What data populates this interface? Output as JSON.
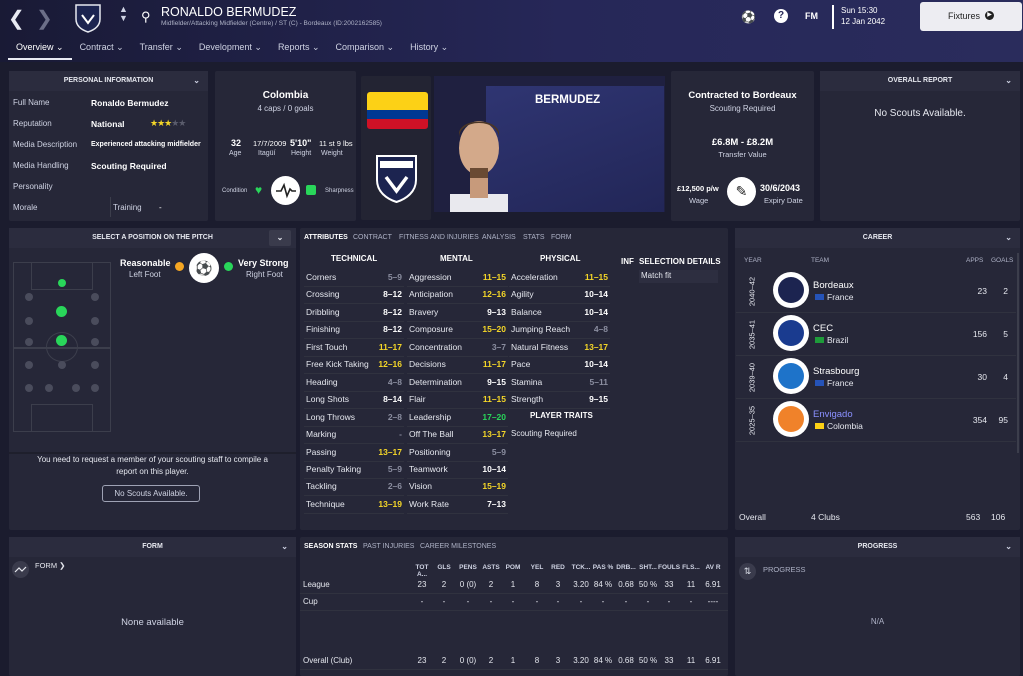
{
  "header": {
    "player_name": "RONALDO BERMUDEZ",
    "player_subtitle": "Midfielder/Attacking Midfielder (Centre) / ST (C) - Bordeaux (ID:2002162585)",
    "fm_label": "FM",
    "day_time": "Sun 15:30",
    "date": "12 Jan 2042",
    "continue_label": "Fixtures"
  },
  "tabs": [
    {
      "label": "Overview"
    },
    {
      "label": "Contract"
    },
    {
      "label": "Transfer"
    },
    {
      "label": "Development"
    },
    {
      "label": "Reports"
    },
    {
      "label": "Comparison"
    },
    {
      "label": "History"
    }
  ],
  "personal": {
    "title": "PERSONAL INFORMATION",
    "rows": [
      {
        "key": "Full Name",
        "value": "Ronaldo Bermudez"
      },
      {
        "key": "Reputation",
        "value": "National"
      },
      {
        "key": "Media Description",
        "value": "Experienced attacking midfielder"
      },
      {
        "key": "Media Handling",
        "value": "Scouting Required"
      },
      {
        "key": "Personality",
        "value": ""
      },
      {
        "key": "Morale",
        "value": ""
      }
    ],
    "training_label": "Training",
    "training_value": "-",
    "reputation_stars": 2.5
  },
  "nation": {
    "country": "Colombia",
    "caps": "4 caps / 0 goals",
    "age": "32",
    "age_label": "Age",
    "dob": "17/7/2009",
    "birthplace": "Itagüí",
    "height": "5'10\"",
    "height_label": "Height",
    "weight": "11 st 9 lbs",
    "weight_label": "Weight",
    "condition_label": "Condition",
    "sharpness_label": "Sharpness"
  },
  "portrait": {
    "shirt_name": "BERMUDEZ"
  },
  "contract": {
    "title": "Contracted to Bordeaux",
    "subtitle": "Scouting Required",
    "value": "£6.8M - £8.2M",
    "value_label": "Transfer Value",
    "wage": "£12,500 p/w",
    "wage_label": "Wage",
    "expiry": "30/6/2043",
    "expiry_label": "Expiry Date"
  },
  "overall_report": {
    "title": "OVERALL REPORT",
    "text": "No Scouts Available."
  },
  "position": {
    "title": "SELECT A POSITION ON THE PITCH",
    "left_foot_rating": "Reasonable",
    "left_foot_label": "Left Foot",
    "right_foot_rating": "Very Strong",
    "right_foot_label": "Right Foot",
    "note": "You need to request a member of your scouting staff to compile a report on this player.",
    "button": "No Scouts Available."
  },
  "attributes": {
    "subtabs": [
      "ATTRIBUTES",
      "CONTRACT",
      "FITNESS AND INJURIES",
      "ANALYSIS",
      "STATS",
      "FORM"
    ],
    "technical_title": "TECHNICAL",
    "mental_title": "MENTAL",
    "physical_title": "PHYSICAL",
    "inf_title": "INF",
    "selection_title": "SELECTION DETAILS",
    "selection_value": "Match fit",
    "traits_title": "PLAYER TRAITS",
    "traits_value": "Scouting Required",
    "technical": [
      {
        "name": "Corners",
        "value": "5–9",
        "tone": "gr"
      },
      {
        "name": "Crossing",
        "value": "8–12",
        "tone": "w"
      },
      {
        "name": "Dribbling",
        "value": "8–12",
        "tone": "w"
      },
      {
        "name": "Finishing",
        "value": "8–12",
        "tone": "w"
      },
      {
        "name": "First Touch",
        "value": "11–17",
        "tone": "y"
      },
      {
        "name": "Free Kick Taking",
        "value": "12–16",
        "tone": "y"
      },
      {
        "name": "Heading",
        "value": "4–8",
        "tone": "gr"
      },
      {
        "name": "Long Shots",
        "value": "8–14",
        "tone": "w"
      },
      {
        "name": "Long Throws",
        "value": "2–8",
        "tone": "gr"
      },
      {
        "name": "Marking",
        "value": "-",
        "tone": "gr"
      },
      {
        "name": "Passing",
        "value": "13–17",
        "tone": "y"
      },
      {
        "name": "Penalty Taking",
        "value": "5–9",
        "tone": "gr"
      },
      {
        "name": "Tackling",
        "value": "2–6",
        "tone": "gr"
      },
      {
        "name": "Technique",
        "value": "13–19",
        "tone": "y"
      }
    ],
    "mental": [
      {
        "name": "Aggression",
        "value": "11–15",
        "tone": "y"
      },
      {
        "name": "Anticipation",
        "value": "12–16",
        "tone": "y"
      },
      {
        "name": "Bravery",
        "value": "9–13",
        "tone": "w"
      },
      {
        "name": "Composure",
        "value": "15–20",
        "tone": "y"
      },
      {
        "name": "Concentration",
        "value": "3–7",
        "tone": "gr"
      },
      {
        "name": "Decisions",
        "value": "11–17",
        "tone": "y"
      },
      {
        "name": "Determination",
        "value": "9–15",
        "tone": "w"
      },
      {
        "name": "Flair",
        "value": "11–15",
        "tone": "y"
      },
      {
        "name": "Leadership",
        "value": "17–20",
        "tone": "g"
      },
      {
        "name": "Off The Ball",
        "value": "13–17",
        "tone": "y"
      },
      {
        "name": "Positioning",
        "value": "5–9",
        "tone": "gr"
      },
      {
        "name": "Teamwork",
        "value": "10–14",
        "tone": "w"
      },
      {
        "name": "Vision",
        "value": "15–19",
        "tone": "y"
      },
      {
        "name": "Work Rate",
        "value": "7–13",
        "tone": "w"
      }
    ],
    "physical": [
      {
        "name": "Acceleration",
        "value": "11–15",
        "tone": "y"
      },
      {
        "name": "Agility",
        "value": "10–14",
        "tone": "w"
      },
      {
        "name": "Balance",
        "value": "10–14",
        "tone": "w"
      },
      {
        "name": "Jumping Reach",
        "value": "4–8",
        "tone": "gr"
      },
      {
        "name": "Natural Fitness",
        "value": "13–17",
        "tone": "y"
      },
      {
        "name": "Pace",
        "value": "10–14",
        "tone": "w"
      },
      {
        "name": "Stamina",
        "value": "5–11",
        "tone": "gr"
      },
      {
        "name": "Strength",
        "value": "9–15",
        "tone": "w"
      }
    ]
  },
  "career": {
    "title": "CAREER",
    "col_year": "YEAR",
    "col_team": "TEAM",
    "col_apps": "APPS",
    "col_goals": "GOALS",
    "rows": [
      {
        "year": "2040–42",
        "team": "Bordeaux",
        "country": "France",
        "apps": "23",
        "goals": "2"
      },
      {
        "year": "2035–41",
        "team": "CEC",
        "country": "Brazil",
        "apps": "156",
        "goals": "5"
      },
      {
        "year": "2039–40",
        "team": "Strasbourg",
        "country": "France",
        "apps": "30",
        "goals": "4"
      },
      {
        "year": "2025–35",
        "team": "Envigado",
        "country": "Colombia",
        "apps": "354",
        "goals": "95"
      }
    ],
    "overall_label": "Overall",
    "overall_clubs": "4 Clubs",
    "overall_apps": "563",
    "overall_goals": "106"
  },
  "form": {
    "title": "FORM",
    "form_link": "FORM",
    "empty": "None available"
  },
  "season_stats": {
    "subtabs": [
      "SEASON STATS",
      "PAST INJURIES",
      "CAREER MILESTONES"
    ],
    "columns": [
      "TOT A...",
      "GLS",
      "PENS",
      "ASTS",
      "POM",
      "YEL",
      "RED",
      "TCK...",
      "PAS %",
      "DRB...",
      "SHT...",
      "FOULS",
      "FLS...",
      "AV R"
    ],
    "rows": [
      {
        "label": "League",
        "values": [
          "23",
          "2",
          "0 (0)",
          "2",
          "1",
          "8",
          "3",
          "3.20",
          "84 %",
          "0.68",
          "50 %",
          "33",
          "11",
          "6.91"
        ]
      },
      {
        "label": "Cup",
        "values": [
          "-",
          "-",
          "-",
          "-",
          "-",
          "-",
          "-",
          "-",
          "-",
          "-",
          "-",
          "-",
          "-",
          "----"
        ]
      },
      {
        "label": "Overall (Club)",
        "values": [
          "23",
          "2",
          "0 (0)",
          "2",
          "1",
          "8",
          "3",
          "3.20",
          "84 %",
          "0.68",
          "50 %",
          "33",
          "11",
          "6.91"
        ]
      }
    ]
  },
  "progress": {
    "title": "PROGRESS",
    "label": "PROGRESS",
    "value": "N/A"
  },
  "colors": {
    "accent": "#f5d728",
    "good": "#29d65a",
    "panel": "#262738"
  }
}
